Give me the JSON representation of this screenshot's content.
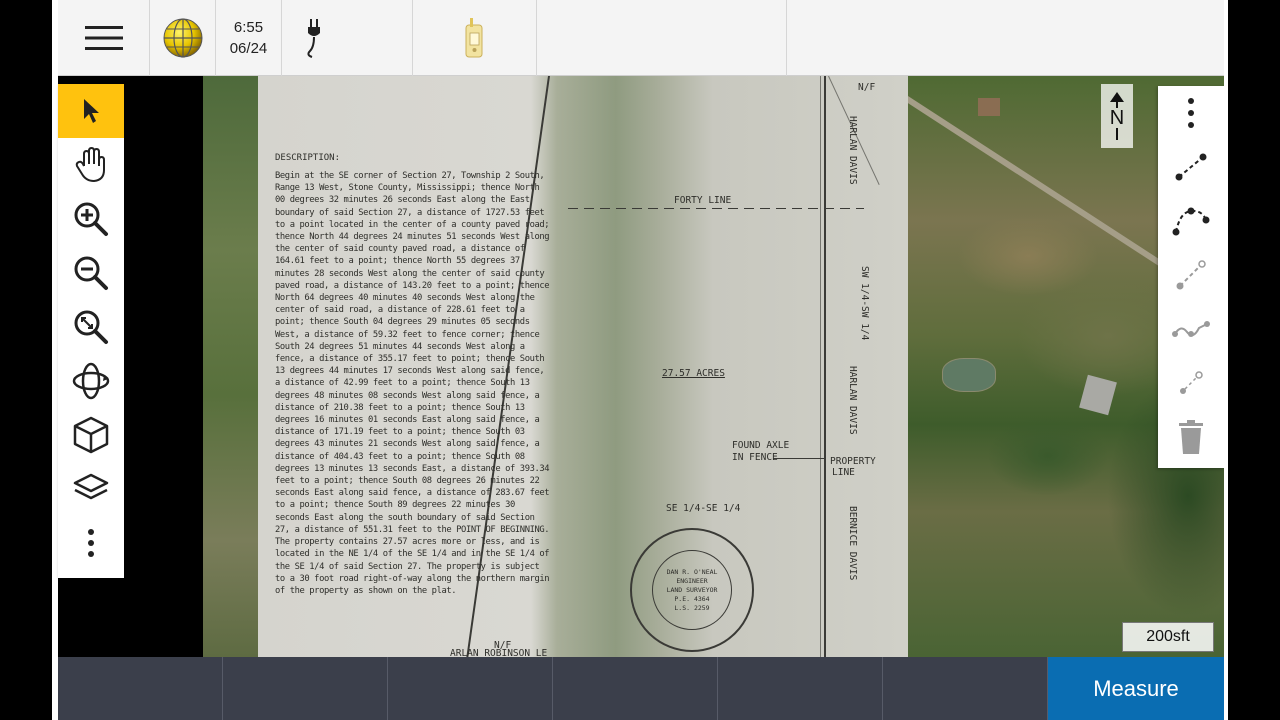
{
  "topbar": {
    "menu_icon": "hamburger-menu-icon",
    "globe_icon": "globe-icon",
    "time": "6:55",
    "date": "06/24",
    "power_icon": "power-plug-icon",
    "receiver_icon": "gnss-receiver-icon"
  },
  "left_toolbar": {
    "items": [
      {
        "icon": "select-arrow-icon",
        "active": true
      },
      {
        "icon": "pan-hand-icon"
      },
      {
        "icon": "zoom-in-icon"
      },
      {
        "icon": "zoom-out-icon"
      },
      {
        "icon": "zoom-extents-icon"
      },
      {
        "icon": "orbit-icon"
      },
      {
        "icon": "3d-cube-icon"
      },
      {
        "icon": "layers-icon"
      },
      {
        "icon": "more-vertical-icon"
      }
    ]
  },
  "right_toolbar": {
    "items": [
      {
        "icon": "more-vertical-icon"
      },
      {
        "icon": "measure-line-icon"
      },
      {
        "icon": "measure-arc-icon"
      },
      {
        "icon": "measure-point-line-icon"
      },
      {
        "icon": "measure-polyline-icon"
      },
      {
        "icon": "measure-point-icon"
      },
      {
        "icon": "trash-icon"
      }
    ]
  },
  "north": {
    "letter": "N"
  },
  "scale": {
    "label": "200sft"
  },
  "plat": {
    "heading": "DESCRIPTION:",
    "description": "Begin at the SE corner of Section 27, Township 2 South, Range 13 West, Stone County, Mississippi; thence North 00 degrees 32 minutes 26 seconds East along the East boundary of said Section 27, a distance of 1727.53 feet to a point located in the center of a county paved road; thence North 44 degrees 24 minutes 51 seconds West along the center of said county paved road, a distance of 164.61 feet to a point; thence North 55 degrees 37 minutes 28 seconds West along the center of said county paved road, a distance of 143.20 feet to a point; thence North 64 degrees 40 minutes 40 seconds West along the center of said road, a distance of 228.61 feet to a point; thence South 04 degrees 29 minutes 05 seconds West, a distance of 59.32 feet to fence corner; thence South 24 degrees 51 minutes 44 seconds West along a fence, a distance of 355.17 feet to point; thence South 13 degrees 44 minutes 17 seconds West along said fence, a distance of 42.99 feet to a point; thence South 13 degrees 48 minutes 08 seconds West along said fence, a distance of 210.38 feet to a point; thence South 13 degrees 16 minutes 01 seconds East along said fence, a distance of 171.19 feet to a point; thence South 03 degrees 43 minutes 21 seconds West along said fence, a distance of 404.43 feet to a point; thence South 08 degrees 13 minutes 13 seconds East, a distance of 393.34 feet to a point; thence South 08 degrees 26 minutes 22 seconds East along said fence, a distance of 283.67 feet to a point; thence South 89 degrees 22 minutes 30 seconds East along the south boundary of said Section 27, a distance of 551.31 feet to the POINT OF BEGINNING. The property contains 27.57 acres more or less, and is located in the NE 1/4 of the SE 1/4 and in the SE 1/4 of the SE 1/4 of said Section 27. The property is subject to a 30 foot road right-of-way along the northern margin of the property as shown on the plat.",
    "forty_line": "FORTY LINE",
    "acres": "27.57 ACRES",
    "found_axle": "FOUND AXLE",
    "in_fence": "IN FENCE",
    "property": "PROPERTY",
    "line": "LINE",
    "se_quarter": "SE 1/4-SE 1/4",
    "sw_quarter": "SW 1/4-SW 1/4",
    "nf1": "N/F",
    "harlan_davis": "HARLAN DAVIS",
    "bernice_davis": "BERNICE DAVIS",
    "arlan_robinson": "ARLAN ROBINSON LE",
    "seal_name": "DAN R. O'NEAL",
    "seal_title": "REGISTERED PROFESSIONAL",
    "seal_engineer": "ENGINEER",
    "seal_surveyor": "LAND SURVEYOR",
    "seal_pe": "P.E. 4364",
    "seal_ls": "L.S. 2259",
    "seal_state": "STATE OF MISSISSIPPI"
  },
  "bottombar": {
    "measure_label": "Measure"
  },
  "colors": {
    "accent_active": "#ffc20e",
    "measure_button": "#0a6db2",
    "bottom_bar": "#3b3f4b"
  }
}
